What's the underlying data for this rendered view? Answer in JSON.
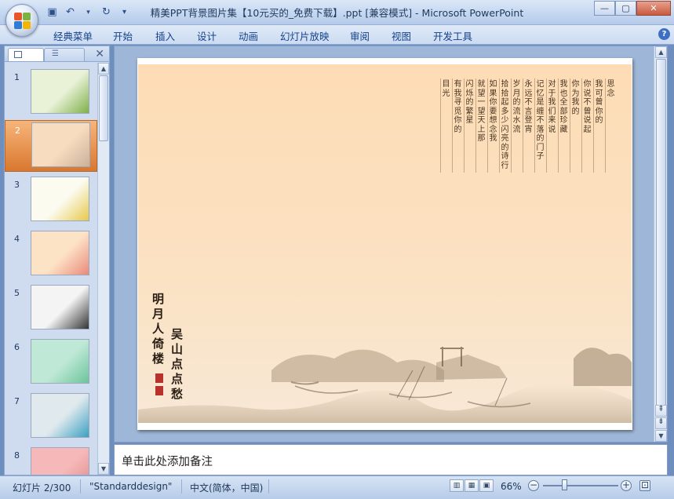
{
  "window": {
    "title": "精美PPT背景图片集【10元买的_免费下载】.ppt [兼容模式] - Microsoft PowerPoint",
    "min_glyph": "—",
    "max_glyph": "▢",
    "close_glyph": "✕"
  },
  "qat": {
    "save": "▣",
    "undo": "↶",
    "redo": "↻",
    "more": "▾"
  },
  "ribbon": {
    "tabs": [
      "经典菜单",
      "开始",
      "插入",
      "设计",
      "动画",
      "幻灯片放映",
      "审阅",
      "视图",
      "开发工具"
    ],
    "help": "?"
  },
  "slides_pane": {
    "close": "✕",
    "outline_glyph": "☰",
    "thumbnails": [
      {
        "num": "1",
        "bg": "#e9f1d7",
        "accent": "#7fb04a"
      },
      {
        "num": "2",
        "bg": "#f8dcc0",
        "accent": "#c9b19a"
      },
      {
        "num": "3",
        "bg": "#fbfbf0",
        "accent": "#e8c84a"
      },
      {
        "num": "4",
        "bg": "#fde3c6",
        "accent": "#e98a7a"
      },
      {
        "num": "5",
        "bg": "#f4f4f4",
        "accent": "#333333"
      },
      {
        "num": "6",
        "bg": "#bfe9d6",
        "accent": "#6cc49a"
      },
      {
        "num": "7",
        "bg": "#dfe9ee",
        "accent": "#3aa0c2"
      },
      {
        "num": "8",
        "bg": "#f6b8b8",
        "accent": "#e08b8b"
      }
    ],
    "selected": "2"
  },
  "slide": {
    "poem_columns": [
      "思念",
      "我可曾你的",
      "你说不曾说起",
      "你为我的",
      "我也全部珍藏",
      "对于我们来说",
      "记忆是缠不落的门子",
      "永远不言登宵",
      "岁月的流水流",
      "拾拾起多少闪亮的诗行",
      "如果你要想念我",
      "就望一望天上那",
      "闪烁的繁星",
      "有我寻觅你的",
      "目光"
    ],
    "signature_left": "明月人倚楼",
    "signature_right": "吴山点点愁"
  },
  "notes": {
    "placeholder": "单击此处添加备注"
  },
  "status": {
    "slide_info": "幻灯片 2/300",
    "theme": "\"Standarddesign\"",
    "language": "中文(简体，中国)",
    "zoom": "66%",
    "zoom_out": "−",
    "zoom_in": "+",
    "fit": "⊡"
  },
  "colors": {
    "accent": "#15428b",
    "selected_thumb": "#e08a3c"
  }
}
